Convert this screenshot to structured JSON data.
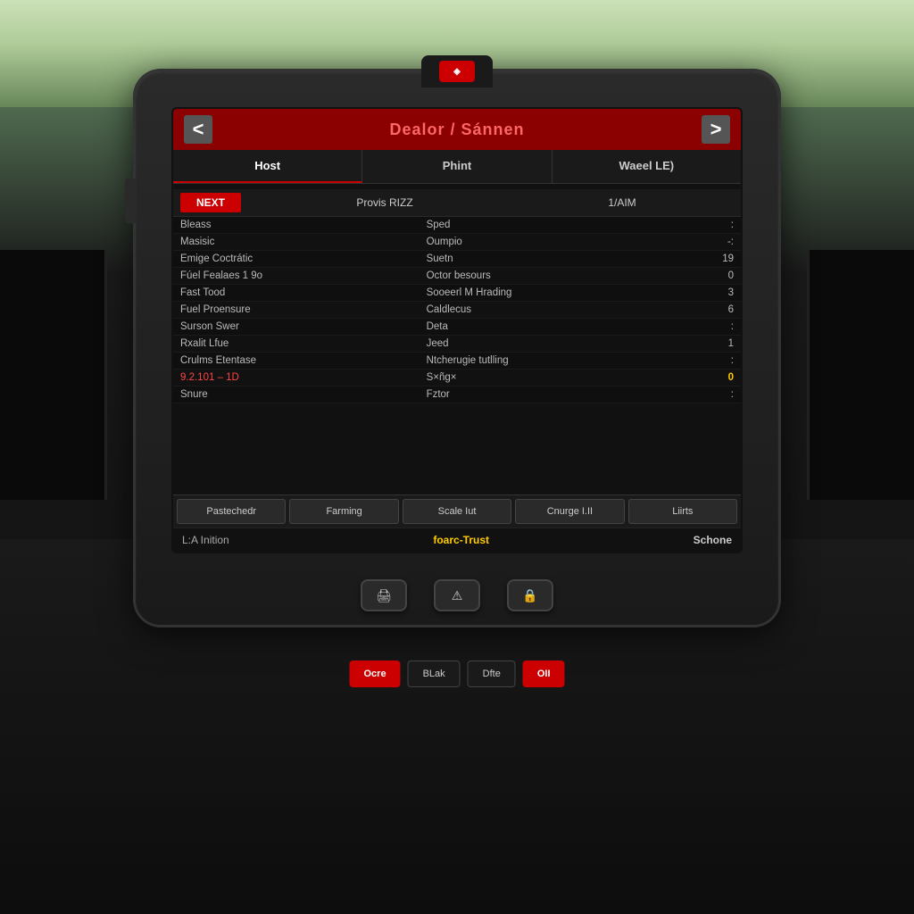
{
  "background": {
    "sky_color": "#c8dfa8",
    "dash_color": "#0d0d0d"
  },
  "device": {
    "logo_text": "◈"
  },
  "screen": {
    "title": "Dealor / Sánnen",
    "nav_left": "<",
    "nav_right": ">",
    "tabs": [
      {
        "label": "Host",
        "active": true
      },
      {
        "label": "Phint",
        "active": false
      },
      {
        "label": "Waeel LE)",
        "active": false
      }
    ],
    "next_button": "NEXT",
    "next_row_col2": "Provis RIZZ",
    "next_row_col3": "1/AIM",
    "rows": [
      {
        "col1": "Bleass",
        "col2": "Sped",
        "col3": ":",
        "highlight": false
      },
      {
        "col1": "Masisic",
        "col2": "Oumpio",
        "col3": "-:",
        "highlight": false
      },
      {
        "col1": "Emige Coctrátic",
        "col2": "Suetn",
        "col3": "19",
        "highlight": false
      },
      {
        "col1": "Fúel Fealaes 1 9o",
        "col2": "Octor besours",
        "col3": "0",
        "highlight": false
      },
      {
        "col1": "Fast Tood",
        "col2": "Sooeerl M Hrading",
        "col3": "3",
        "highlight": false
      },
      {
        "col1": "Fuel Proensure",
        "col2": "Caldlecus",
        "col3": "6",
        "highlight": false
      },
      {
        "col1": "Surson Swer",
        "col2": "Deta",
        "col3": ":",
        "highlight": false
      },
      {
        "col1": "Rxalit Lfue",
        "col2": "Jeed",
        "col3": "1",
        "highlight": false
      },
      {
        "col1": "Crulms Etentase",
        "col2": "Ntcherugie tutlling",
        "col3": ":",
        "highlight": false
      },
      {
        "col1": "9.2.101 – 1D",
        "col2": "S×ñg×",
        "col3": "0",
        "highlight": true
      },
      {
        "col1": "Snure",
        "col2": "Fztor",
        "col3": ":",
        "highlight": false
      }
    ],
    "bottom_tabs": [
      {
        "label": "Pastechedr",
        "active": false
      },
      {
        "label": "Farming",
        "active": false
      },
      {
        "label": "Scale Iut",
        "active": false
      },
      {
        "label": "Cnurge I.II",
        "active": false
      },
      {
        "label": "Liirts",
        "active": false
      }
    ],
    "status_left": "L:A Inition",
    "status_center": "foarc-Trust",
    "status_right": "Schone"
  },
  "physical_buttons": [
    {
      "icon": "🖨",
      "label": "print-icon"
    },
    {
      "icon": "⚠",
      "label": "warning-icon"
    },
    {
      "icon": "🔒",
      "label": "lock-icon"
    }
  ],
  "key_buttons": [
    {
      "label": "Ocre",
      "style": "red"
    },
    {
      "label": "BLak",
      "style": "dark"
    },
    {
      "label": "Dfte",
      "style": "dark"
    },
    {
      "label": "OII",
      "style": "red"
    }
  ]
}
